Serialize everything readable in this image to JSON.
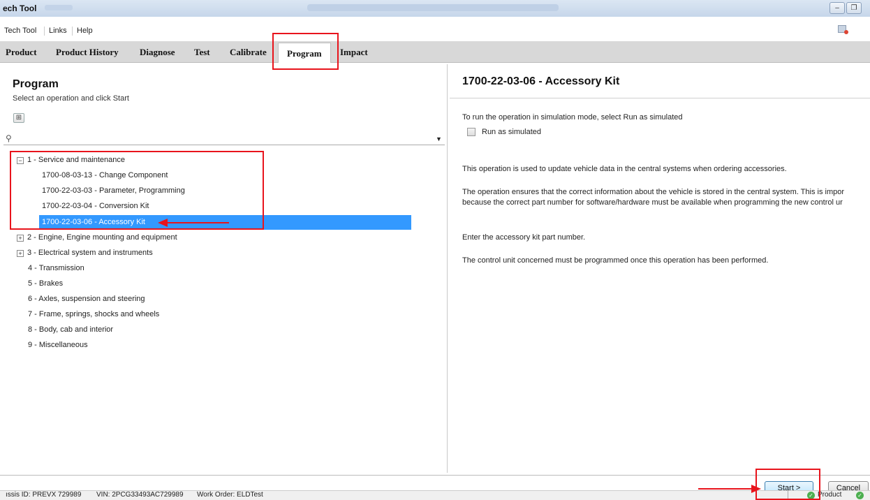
{
  "window": {
    "title": "ech Tool",
    "minimize_glyph": "–",
    "restore_glyph": "❐"
  },
  "menu": {
    "items": [
      "Tech Tool",
      "Links",
      "Help"
    ]
  },
  "tabs": [
    "Product",
    "Product History",
    "Diagnose",
    "Test",
    "Calibrate",
    "Program",
    "Impact"
  ],
  "active_tab": "Program",
  "left": {
    "heading": "Program",
    "subheading": "Select an operation and click Start",
    "expand_glyph": "⊞",
    "search_icon": "magnifier-icon",
    "search_glyph": "⚲",
    "dropdown_glyph": "▼",
    "tree": [
      {
        "label": "1 - Service and maintenance",
        "toggle": "−"
      },
      {
        "label": "1700-08-03-13 - Change Component"
      },
      {
        "label": "1700-22-03-03 - Parameter, Programming"
      },
      {
        "label": "1700-22-03-04 - Conversion Kit"
      },
      {
        "label": "1700-22-03-06 - Accessory Kit",
        "selected": true
      },
      {
        "label": "2 - Engine, Engine mounting and equipment",
        "toggle": "+"
      },
      {
        "label": "3 - Electrical system and instruments",
        "toggle": "+"
      },
      {
        "label": "4 - Transmission"
      },
      {
        "label": "5 - Brakes"
      },
      {
        "label": "6 - Axles, suspension and steering"
      },
      {
        "label": "7 - Frame, springs, shocks and wheels"
      },
      {
        "label": "8 - Body, cab and interior"
      },
      {
        "label": "9 - Miscellaneous"
      }
    ]
  },
  "right": {
    "heading": "1700-22-03-06 - Accessory Kit",
    "simulation_hint": "To run the operation in simulation mode, select Run as simulated",
    "checkbox_label": "Run as simulated",
    "description_1": "This operation is used to update vehicle data in the central systems when ordering accessories.",
    "description_2a": "The operation ensures that the correct information about the vehicle is stored in the central system. This is impor",
    "description_2b": "because the correct part number for software/hardware must be available when programming the new control ur",
    "instruction": "Enter the accessory kit part number.",
    "note": "The control unit concerned must be programmed once this operation has been performed."
  },
  "buttons": {
    "start": "Start >",
    "cancel": "Cancel"
  },
  "status": {
    "chassis": "ıssis ID: PREVX 729989",
    "vin": "VIN: 2PCG33493AC729989",
    "work_order": "Work Order: ELDTest",
    "product": "Product",
    "ok_glyph": "✓"
  },
  "colors": {
    "selection": "#3399ff",
    "annotation": "#e8141c"
  }
}
